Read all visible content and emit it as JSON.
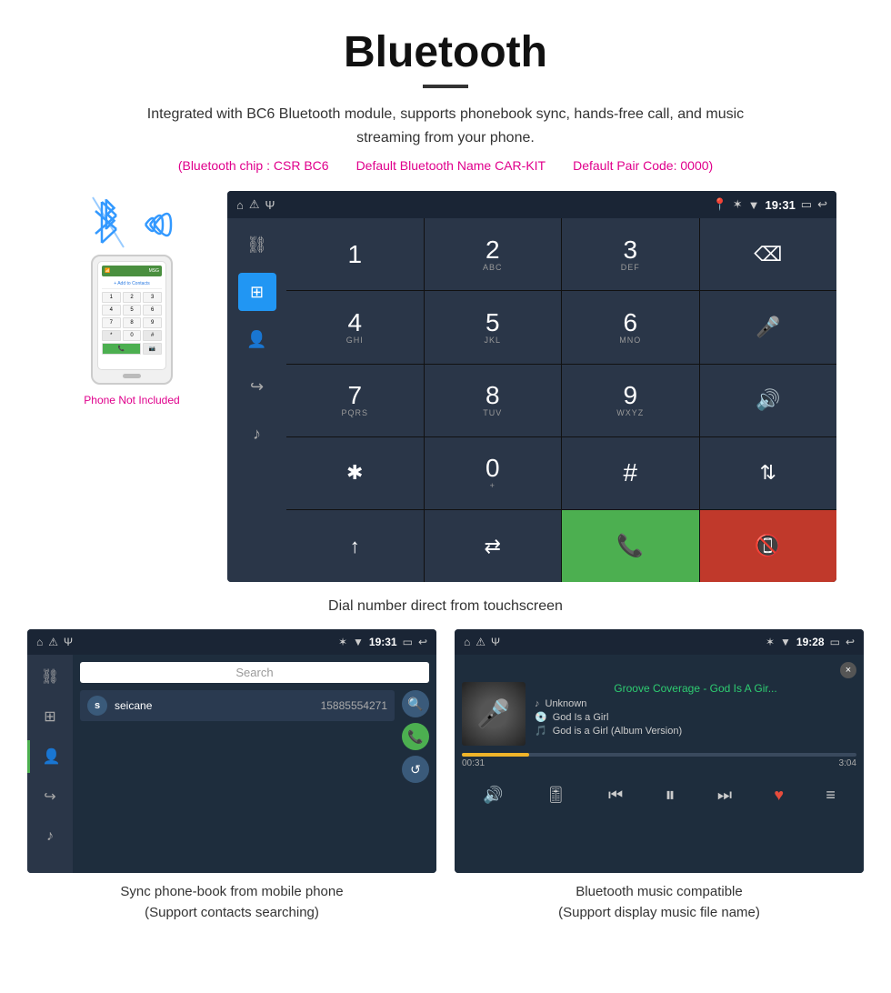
{
  "page": {
    "title": "Bluetooth",
    "divider": true,
    "description": "Integrated with BC6 Bluetooth module, supports phonebook sync, hands-free call, and music streaming from your phone.",
    "spec1": "(Bluetooth chip : CSR BC6",
    "spec2": "Default Bluetooth Name CAR-KIT",
    "spec3": "Default Pair Code: 0000)",
    "dial_caption": "Dial number direct from touchscreen",
    "phonebook_caption1": "Sync phone-book from mobile phone",
    "phonebook_caption2": "(Support contacts searching)",
    "music_caption1": "Bluetooth music compatible",
    "music_caption2": "(Support display music file name)"
  },
  "status_bar": {
    "time": "19:31",
    "time2": "19:31",
    "time3": "19:28"
  },
  "dial_pad": {
    "keys": [
      {
        "main": "1",
        "sub": ""
      },
      {
        "main": "2",
        "sub": "ABC"
      },
      {
        "main": "3",
        "sub": "DEF"
      },
      {
        "main": "⌫",
        "sub": ""
      },
      {
        "main": "4",
        "sub": "GHI"
      },
      {
        "main": "5",
        "sub": "JKL"
      },
      {
        "main": "6",
        "sub": "MNO"
      },
      {
        "main": "🎤",
        "sub": ""
      },
      {
        "main": "7",
        "sub": "PQRS"
      },
      {
        "main": "8",
        "sub": "TUV"
      },
      {
        "main": "9",
        "sub": "WXYZ"
      },
      {
        "main": "🔊",
        "sub": ""
      },
      {
        "main": "✱",
        "sub": ""
      },
      {
        "main": "0",
        "sub": "+"
      },
      {
        "main": "#",
        "sub": ""
      },
      {
        "main": "⇅",
        "sub": ""
      },
      {
        "main": "↑",
        "sub": ""
      },
      {
        "main": "⇄",
        "sub": ""
      },
      {
        "main": "📞",
        "sub": ""
      },
      {
        "main": "📵",
        "sub": ""
      }
    ]
  },
  "phonebook": {
    "search_placeholder": "Search",
    "contact_initial": "s",
    "contact_name": "seicane",
    "contact_number": "15885554271"
  },
  "music": {
    "close_label": "×",
    "title": "Groove Coverage - God Is A Gir...",
    "artist": "Unknown",
    "album": "God Is a Girl",
    "track": "God is a Girl (Album Version)",
    "time_current": "00:31",
    "time_total": "3:04",
    "progress_percent": 17
  },
  "phone_not_included": "Phone Not Included"
}
